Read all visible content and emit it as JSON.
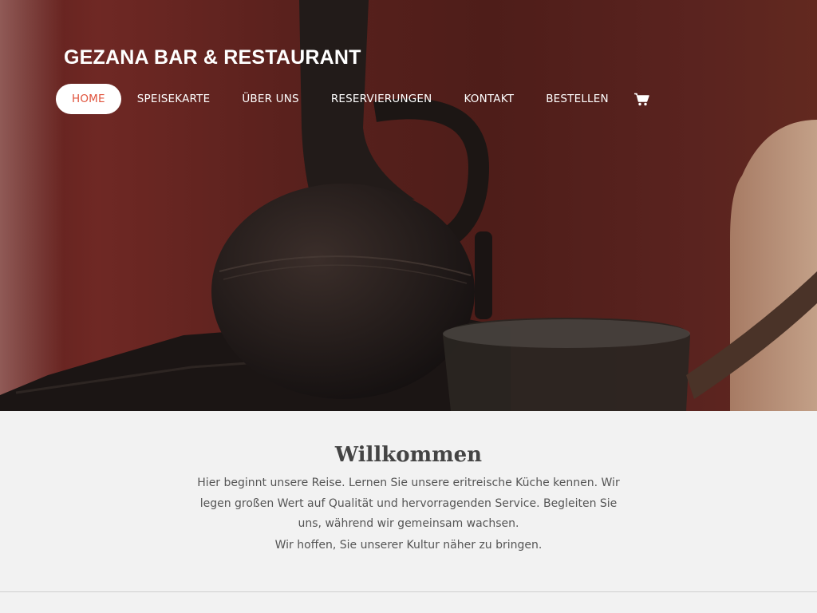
{
  "site": {
    "title": "GEZANA BAR & RESTAURANT"
  },
  "nav": {
    "items": [
      {
        "label": "HOME",
        "active": true
      },
      {
        "label": "SPEISEKARTE"
      },
      {
        "label": "ÜBER UNS"
      },
      {
        "label": "RESERVIERUNGEN"
      },
      {
        "label": "KONTAKT"
      },
      {
        "label": "BESTELLEN"
      }
    ],
    "cart_icon": "cart-icon"
  },
  "welcome": {
    "heading": "Willkommen",
    "paragraph": "Hier beginnt unsere Reise. Lernen Sie unsere eritreische Küche kennen. Wir legen großen Wert auf Qualität und hervorragenden Service. Begleiten Sie uns, während wir gemeinsam wachsen.",
    "paragraph2": "Wir hoffen, Sie unserer Kultur näher zu bringen."
  },
  "colors": {
    "accent": "#e0533c",
    "hero_bg": "#5a211d",
    "section_bg": "#f2f2f2"
  }
}
